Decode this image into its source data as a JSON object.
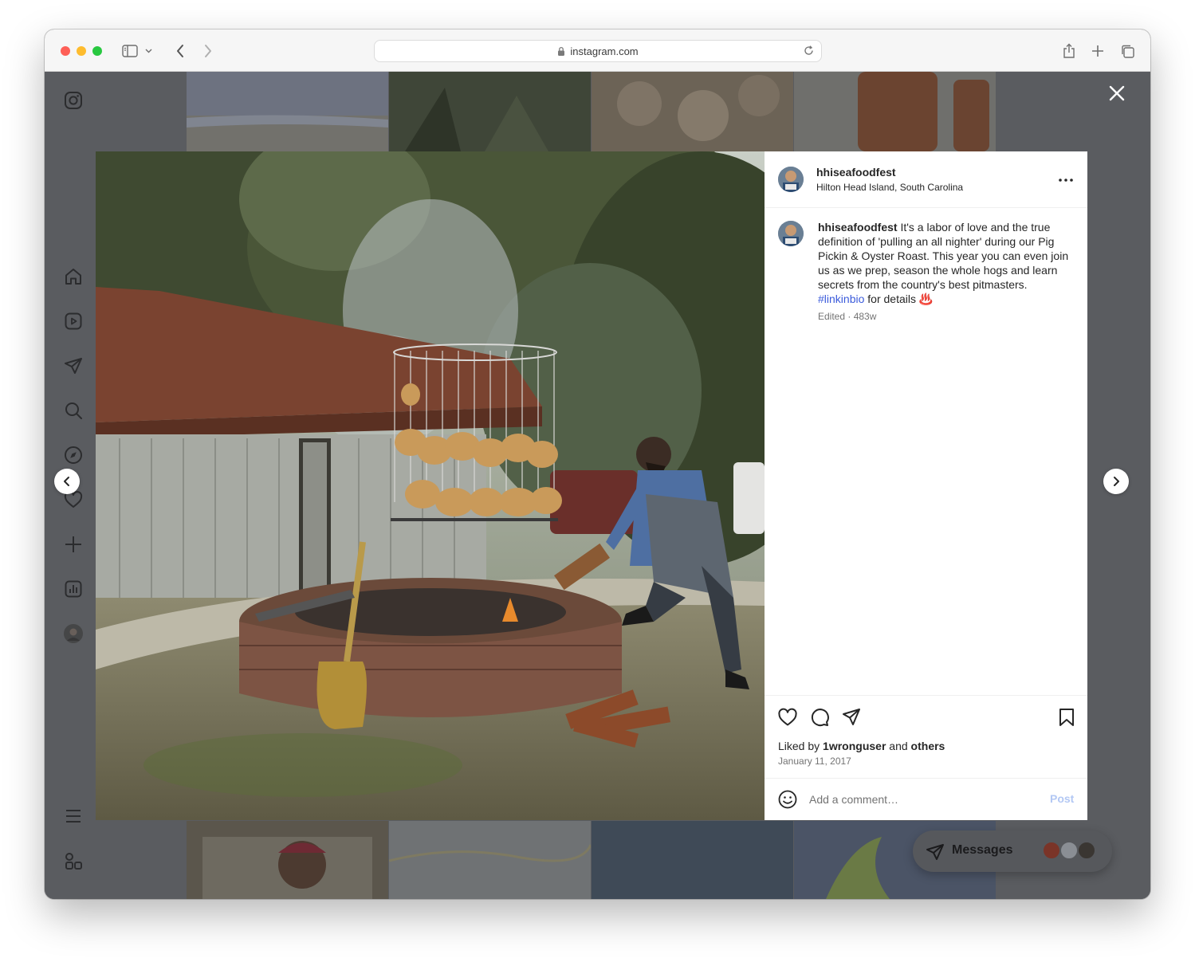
{
  "browser": {
    "url": "instagram.com"
  },
  "post": {
    "username": "hhiseafoodfest",
    "location": "Hilton Head Island, South Carolina",
    "caption": {
      "username": "hhiseafoodfest",
      "text": " It's a labor of love and the true definition of 'pulling an all nighter' during our Pig Pickin & Oyster Roast. This year you can even join us as we prep, season the whole hogs and learn secrets from the country's best pitmasters. ",
      "hashtag": "#linkinbio",
      "suffix": " for details ♨️"
    },
    "edited": "Edited · 483w",
    "liked_by": {
      "prefix": "Liked by ",
      "user": "1wronguser",
      "middle": " and ",
      "others": "others"
    },
    "date": "January 11, 2017",
    "comment_placeholder": "Add a comment…",
    "post_button": "Post"
  },
  "messages": {
    "label": "Messages"
  },
  "icons": {
    "sidebar": [
      "instagram-icon",
      "home-icon",
      "reels-icon",
      "direct-icon",
      "search-icon",
      "explore-icon",
      "heart-icon",
      "create-icon",
      "insights-icon",
      "profile-avatar",
      "menu-icon",
      "more-apps-icon"
    ],
    "actions": [
      "heart-icon",
      "comment-icon",
      "share-icon",
      "bookmark-icon"
    ]
  },
  "colors": {
    "hashtag": "#3b5bdb",
    "post_button_disabled": "#b3c8f4",
    "overlay": "#5a5c60"
  }
}
